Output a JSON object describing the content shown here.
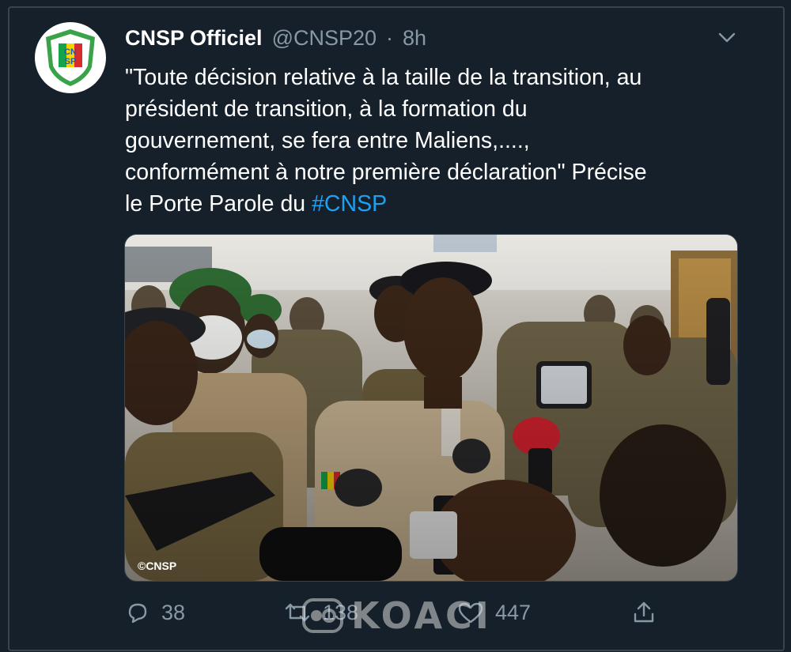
{
  "tweet": {
    "display_name": "CNSP Officiel",
    "handle": "@CNSP20",
    "separator": "·",
    "time": "8h",
    "text_lines": [
      "\"Toute décision relative à la taille de la transition, au",
      "président de transition, à la formation du",
      "gouvernement, se fera entre Maliens,....,",
      "conformément à notre première déclaration\" Précise",
      "le Porte Parole du "
    ],
    "hashtag": "#CNSP",
    "avatar_logo_text": "CNSP",
    "photo_caption_watermark": "©CNSP"
  },
  "actions": {
    "reply_count": "38",
    "retweet_count": "138",
    "like_count": "447"
  },
  "watermark": {
    "text": "KOACI"
  },
  "colors": {
    "background": "#15202b",
    "muted": "#8899a6",
    "link": "#1da1f2",
    "border": "#38444d"
  }
}
